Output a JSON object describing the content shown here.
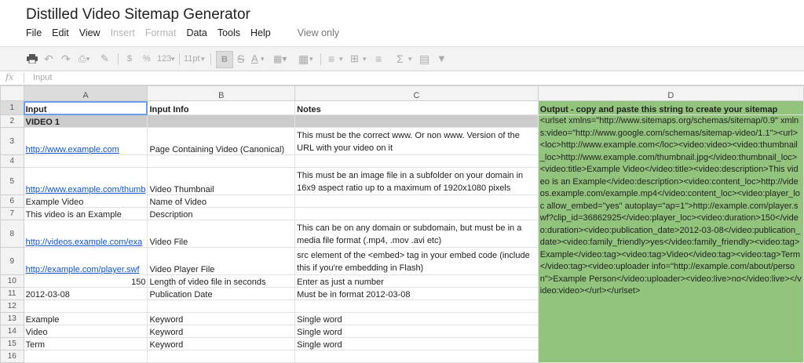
{
  "doc_title": "Distilled Video Sitemap Generator",
  "menu": [
    "File",
    "Edit",
    "View",
    "Insert",
    "Format",
    "Data",
    "Tools",
    "Help"
  ],
  "menu_disabled": [
    "Insert",
    "Format"
  ],
  "view_only": "View only",
  "toolbar": {
    "currency": "$",
    "percent": "%",
    "number_format": "123",
    "font_size": "11pt",
    "bold": "B"
  },
  "formula_bar": {
    "fx": "fx",
    "content": "Input"
  },
  "columns": [
    "A",
    "B",
    "C",
    "D"
  ],
  "rows": [
    {
      "n": "1",
      "a": "Input",
      "b": "Input Info",
      "c": "Notes"
    },
    {
      "n": "2",
      "a": "VIDEO 1",
      "b": "",
      "c": ""
    },
    {
      "n": "3",
      "a": "http://www.example.com",
      "b": "Page Containing Video (Canonical)",
      "c": "This must be the correct www. Or non www. Version of the URL with your video on it"
    },
    {
      "n": "4",
      "a": "",
      "b": "",
      "c": ""
    },
    {
      "n": "5",
      "a": "http://www.example.com/thumb",
      "b": "Video Thumbnail",
      "c": "This must be an image file in a subfolder on your domain in 16x9 aspect ratio up to a maximum of 1920x1080 pixels"
    },
    {
      "n": "6",
      "a": "Example Video",
      "b": "Name of Video",
      "c": ""
    },
    {
      "n": "7",
      "a": "This video is an Example",
      "b": "Description",
      "c": ""
    },
    {
      "n": "8",
      "a": "http://videos.example.com/exa",
      "b": "Video File",
      "c": "This can be on any domain or subdomain, but must be in a media file format (.mp4, .mov .avi etc)"
    },
    {
      "n": "9",
      "a": "http://example.com/player.swf",
      "b": "Video Player File",
      "c": "src element of the <embed> tag in your embed code (include this if you're embedding in Flash)"
    },
    {
      "n": "10",
      "a": "150",
      "b": "Length of video file in seconds",
      "c": "Enter as just a number"
    },
    {
      "n": "11",
      "a": "2012-03-08",
      "b": "Publication Date",
      "c": "Must be in format 2012-03-08"
    },
    {
      "n": "12",
      "a": "",
      "b": "",
      "c": ""
    },
    {
      "n": "13",
      "a": "Example",
      "b": "Keyword",
      "c": "Single word"
    },
    {
      "n": "14",
      "a": "Video",
      "b": "Keyword",
      "c": "Single word"
    },
    {
      "n": "15",
      "a": "Term",
      "b": "Keyword",
      "c": "Single word"
    },
    {
      "n": "16",
      "a": "",
      "b": "",
      "c": ""
    }
  ],
  "output_header": "Output - copy and paste this string to create your sitemap",
  "output_text": "<urlset xmlns=\"http://www.sitemaps.org/schemas/sitemap/0.9\" xmlns:video=\"http://www.google.com/schemas/sitemap-video/1.1\"><url><loc>http://www.example.com</loc><video:video><video:thumbnail_loc>http://www.example.com/thumbnail.jpg</video:thumbnail_loc><video:title>Example Video</video:title><video:description>This video is an Example</video:description><video:content_loc>http://videos.example.com/example.mp4</video:content_loc><video:player_loc allow_embed=\"yes\" autoplay=\"ap=1\">http://example.com/player.swf?clip_id=36862925</video:player_loc><video:duration>150</video:duration><video:publication_date>2012-03-08</video:publication_date><video:family_friendly>yes</video:family_friendly><video:tag>Example</video:tag><video:tag>Video</video:tag><video:tag>Term</video:tag><video:uploader info=\"http://example.com/about/person\">Example Person</video:uploader><video:live>no</video:live></video:video></url></urlset>",
  "colors": {
    "output_bg": "#93c47d",
    "section_bg": "#cccccc",
    "link": "#1155cc",
    "selection": "#6d9eeb"
  }
}
